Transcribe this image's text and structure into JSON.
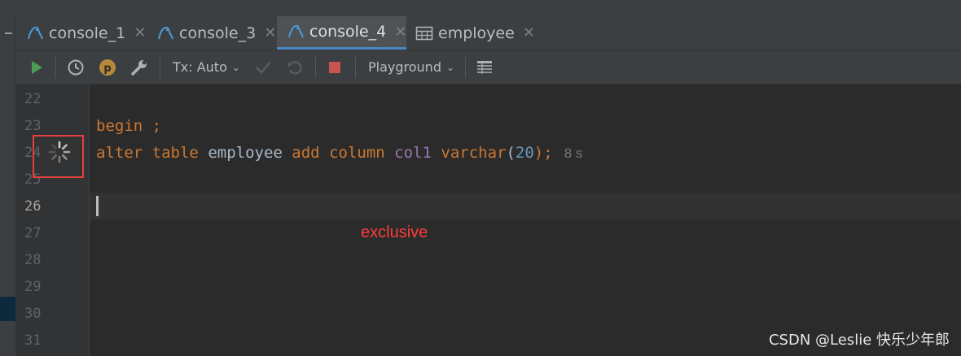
{
  "tabs": [
    {
      "label": "console_1",
      "icon": "mysql-console-icon",
      "active": false
    },
    {
      "label": "console_3",
      "icon": "mysql-console-icon",
      "active": false
    },
    {
      "label": "console_4",
      "icon": "mysql-console-icon",
      "active": true
    },
    {
      "label": "employee",
      "icon": "table-icon",
      "active": false
    }
  ],
  "toolbar": {
    "tx_mode": "Tx: Auto",
    "playground": "Playground"
  },
  "gutter": {
    "line_numbers": [
      "22",
      "23",
      "24",
      "25",
      "26",
      "27",
      "28",
      "29",
      "30",
      "31"
    ],
    "current_line": "26"
  },
  "code": {
    "line23": {
      "begin": "begin",
      "semi": " ;"
    },
    "line24": {
      "alter": "alter",
      "table": "table",
      "table_name": "employee",
      "add": "add",
      "column": "column",
      "col_name": "col1",
      "type": "varchar",
      "open": "(",
      "size": "20",
      "close": ");"
    },
    "elapsed": "8 s"
  },
  "annotation": "exclusive",
  "watermark": "CSDN @Leslie 快乐少年郎",
  "colors": {
    "accent": "#4a88c7",
    "keyword": "#cc7832",
    "number": "#6897bb",
    "column": "#9876aa",
    "annotation": "#ff3b3b"
  }
}
